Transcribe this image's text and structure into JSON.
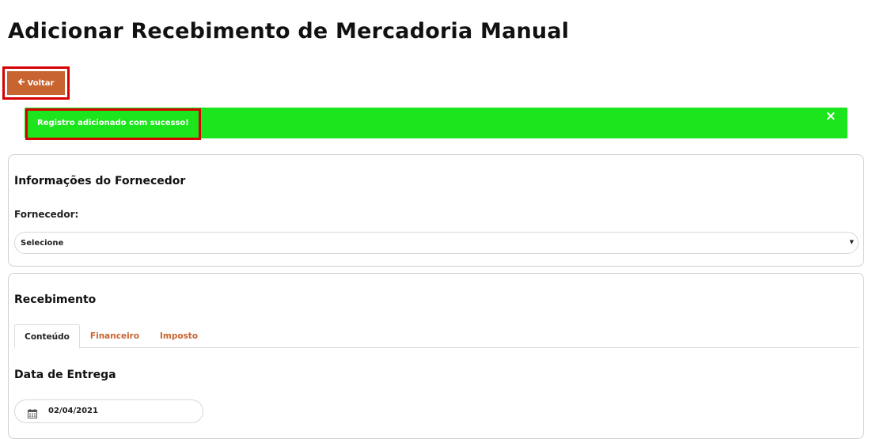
{
  "page": {
    "title": "Adicionar Recebimento de Mercadoria Manual"
  },
  "toolbar": {
    "back_label": "Voltar",
    "back_icon": "arrow-left-icon"
  },
  "alert": {
    "message": "Registro adicionado com sucesso!",
    "close_symbol": "×",
    "color": "#1de51d"
  },
  "supplier_section": {
    "title": "Informações do Fornecedor",
    "supplier_label": "Fornecedor:",
    "supplier_select_value": "Selecione"
  },
  "receiving_section": {
    "title": "Recebimento",
    "tabs": [
      {
        "label": "Conteúdo",
        "active": true
      },
      {
        "label": "Financeiro",
        "active": false
      },
      {
        "label": "Imposto",
        "active": false
      }
    ],
    "delivery_date_title": "Data de Entrega",
    "delivery_date_value": "02/04/2021"
  },
  "colors": {
    "accent": "#c8642f",
    "highlight_border": "#d60000",
    "success": "#1de51d"
  }
}
